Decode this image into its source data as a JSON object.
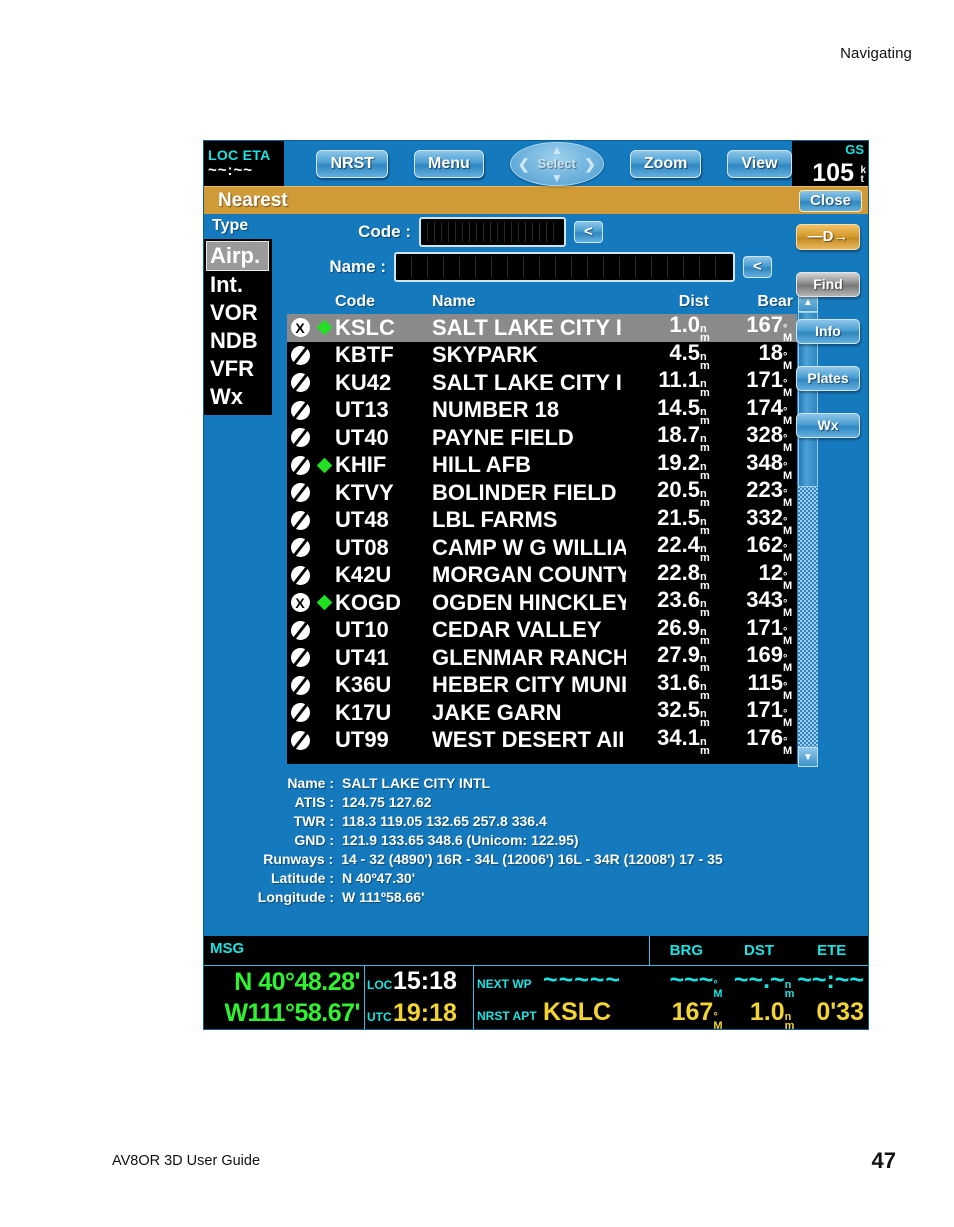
{
  "document": {
    "header": "Navigating",
    "footer_left": "AV8OR 3D User Guide",
    "page_number": "47"
  },
  "device": {
    "topbar": {
      "loc_eta_label": "LOC ETA",
      "loc_eta_value": "~~:~~",
      "buttons": [
        "NRST",
        "Menu",
        "Zoom",
        "View"
      ],
      "select_label": "Select",
      "gs_label": "GS",
      "gs_value": "105",
      "gs_unit_top": "k",
      "gs_unit_bot": "t"
    },
    "title": {
      "text": "Nearest",
      "close_label": "Close"
    },
    "type_panel": {
      "header": "Type",
      "items": [
        "Airp.",
        "Int.",
        "VOR",
        "NDB",
        "VFR",
        "Wx"
      ],
      "selected": "Airp."
    },
    "search": {
      "code_label": "Code :",
      "code_value": "",
      "name_label": "Name :",
      "name_value": "",
      "backspace_label": "<"
    },
    "list": {
      "columns": [
        "Code",
        "Name",
        "Dist",
        "Bear"
      ],
      "dist_unit_top": "n",
      "dist_unit_bot": "m",
      "bear_unit_top": "°",
      "bear_unit_bot": "M",
      "rows": [
        {
          "status": "X",
          "fuel": true,
          "code": "KSLC",
          "name": "SALT LAKE CITY I",
          "dist": "1.0",
          "bear": "167",
          "selected": true
        },
        {
          "status": "/",
          "fuel": false,
          "code": "KBTF",
          "name": "SKYPARK",
          "dist": "4.5",
          "bear": "18",
          "selected": false
        },
        {
          "status": "/",
          "fuel": false,
          "code": "KU42",
          "name": "SALT LAKE CITY I",
          "dist": "11.1",
          "bear": "171",
          "selected": false
        },
        {
          "status": "/",
          "fuel": false,
          "code": "UT13",
          "name": "NUMBER 18",
          "dist": "14.5",
          "bear": "174",
          "selected": false
        },
        {
          "status": "/",
          "fuel": false,
          "code": "UT40",
          "name": "PAYNE FIELD",
          "dist": "18.7",
          "bear": "328",
          "selected": false
        },
        {
          "status": "/",
          "fuel": true,
          "code": "KHIF",
          "name": "HILL AFB",
          "dist": "19.2",
          "bear": "348",
          "selected": false
        },
        {
          "status": "/",
          "fuel": false,
          "code": "KTVY",
          "name": "BOLINDER FIELD ",
          "dist": "20.5",
          "bear": "223",
          "selected": false
        },
        {
          "status": "/",
          "fuel": false,
          "code": "UT48",
          "name": "LBL FARMS",
          "dist": "21.5",
          "bear": "332",
          "selected": false
        },
        {
          "status": "/",
          "fuel": false,
          "code": "UT08",
          "name": "CAMP W G WILLIA",
          "dist": "22.4",
          "bear": "162",
          "selected": false
        },
        {
          "status": "/",
          "fuel": false,
          "code": "K42U",
          "name": "MORGAN COUNTY",
          "dist": "22.8",
          "bear": "12",
          "selected": false
        },
        {
          "status": "X",
          "fuel": true,
          "code": "KOGD",
          "name": "OGDEN HINCKLEY",
          "dist": "23.6",
          "bear": "343",
          "selected": false
        },
        {
          "status": "/",
          "fuel": false,
          "code": "UT10",
          "name": "CEDAR VALLEY",
          "dist": "26.9",
          "bear": "171",
          "selected": false
        },
        {
          "status": "/",
          "fuel": false,
          "code": "UT41",
          "name": "GLENMAR RANCH",
          "dist": "27.9",
          "bear": "169",
          "selected": false
        },
        {
          "status": "/",
          "fuel": false,
          "code": "K36U",
          "name": "HEBER CITY MUNI",
          "dist": "31.6",
          "bear": "115",
          "selected": false
        },
        {
          "status": "/",
          "fuel": false,
          "code": "K17U",
          "name": "JAKE GARN",
          "dist": "32.5",
          "bear": "171",
          "selected": false
        },
        {
          "status": "/",
          "fuel": false,
          "code": "UT99",
          "name": "WEST DESERT AII",
          "dist": "34.1",
          "bear": "176",
          "selected": false
        }
      ]
    },
    "side_buttons": [
      {
        "label": "D",
        "name": "direct-to"
      },
      {
        "label": "Find",
        "name": "find"
      },
      {
        "label": "Info",
        "name": "info"
      },
      {
        "label": "Plates",
        "name": "plates"
      },
      {
        "label": "Wx",
        "name": "wx"
      }
    ],
    "detail": {
      "name_label": "Name :",
      "name_value": "SALT LAKE CITY INTL",
      "atis_label": "ATIS :",
      "atis_value": "124.75  127.62",
      "twr_label": "TWR :",
      "twr_value": "118.3  119.05  132.65  257.8  336.4",
      "gnd_label": "GND :",
      "gnd_value": "121.9  133.65  348.6  (Unicom: 122.95)",
      "runways_label": "Runways :",
      "runways_value": "14 - 32 (4890')  16R - 34L (12006')  16L - 34R (12008')  17 - 35",
      "lat_label": "Latitude :",
      "lat_value": "N 40º47.30'",
      "lon_label": "Longitude :",
      "lon_value": "W 111º58.66'"
    },
    "status_bar": {
      "msg_label": "MSG",
      "col_brg": "BRG",
      "col_dst": "DST",
      "col_ete": "ETE",
      "lat": "N  40°48.28'",
      "lon": "W111°58.67'",
      "loc_label": "LOC",
      "loc_time": "15:18",
      "utc_label": "UTC",
      "utc_time": "19:18",
      "next_wp_label": "NEXT WP",
      "next_wp_id": "~~~~~",
      "next_wp_brg": "~~~",
      "next_wp_dst": "~~.~",
      "next_wp_ete": "~~:~~",
      "nrst_apt_label": "NRST APT",
      "nrst_apt_id": "KSLC",
      "nrst_apt_brg": "167",
      "nrst_apt_dst": "1.0",
      "nrst_apt_ete": "0'33",
      "brg_unit_top": "°",
      "brg_unit_bot": "M",
      "dst_unit_top": "n",
      "dst_unit_bot": "m"
    }
  }
}
